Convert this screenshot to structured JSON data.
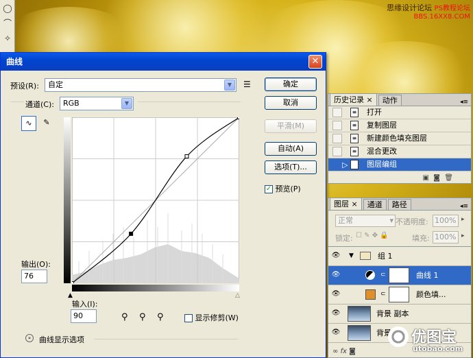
{
  "watermark": {
    "line1": "思缘设计论坛",
    "line2": "PS教程论坛",
    "line3": "BBS.16XX8.COM"
  },
  "dialog": {
    "title": "曲线",
    "close": "✕",
    "preset_label": "预设(R):",
    "preset_value": "自定",
    "channel_label": "通道(C):",
    "channel_value": "RGB",
    "buttons": {
      "ok": "确定",
      "cancel": "取消",
      "smooth": "平滑(M)",
      "auto": "自动(A)",
      "options": "选项(T)..."
    },
    "preview_label": "预览(P)",
    "preview_checked": true,
    "output_label": "输出(O):",
    "output_value": "76",
    "input_label": "输入(I):",
    "input_value": "90",
    "show_clipping_label": "显示修剪(W)",
    "curve_options_label": "曲线显示选项"
  },
  "curve": {
    "points": [
      [
        0,
        0
      ],
      [
        90,
        76
      ],
      [
        175,
        195
      ],
      [
        255,
        255
      ]
    ]
  },
  "history_panel": {
    "tabs": [
      {
        "label": "历史记录",
        "active": true
      },
      {
        "label": "动作",
        "active": false
      }
    ],
    "items": [
      {
        "label": "打开",
        "selected": false
      },
      {
        "label": "复制图层",
        "selected": false
      },
      {
        "label": "新建颜色填充图层",
        "selected": false
      },
      {
        "label": "混合更改",
        "selected": false
      },
      {
        "label": "图层编组",
        "selected": true
      }
    ]
  },
  "layers_panel": {
    "tabs": [
      {
        "label": "图层",
        "active": true
      },
      {
        "label": "通道",
        "active": false
      },
      {
        "label": "路径",
        "active": false
      }
    ],
    "blend_mode": "正常",
    "opacity_label": "不透明度:",
    "opacity_value": "100%",
    "lock_label": "锁定:",
    "fill_label": "填充:",
    "fill_value": "100%",
    "layers": [
      {
        "name": "组 1",
        "type": "group",
        "selected": false
      },
      {
        "name": "曲线 1",
        "type": "adjustment",
        "selected": true
      },
      {
        "name": "颜色填...",
        "type": "fill",
        "selected": false,
        "color": "#e0902a"
      },
      {
        "name": "背景 副本",
        "type": "image",
        "selected": false
      },
      {
        "name": "背景",
        "type": "image",
        "selected": false
      }
    ]
  },
  "logo": {
    "main": "优图宝",
    "sub": "utobao.com"
  },
  "colors": {
    "accent": "#3169c6",
    "title_bar": "#0045d0",
    "fill_swatch": "#e0902a"
  }
}
